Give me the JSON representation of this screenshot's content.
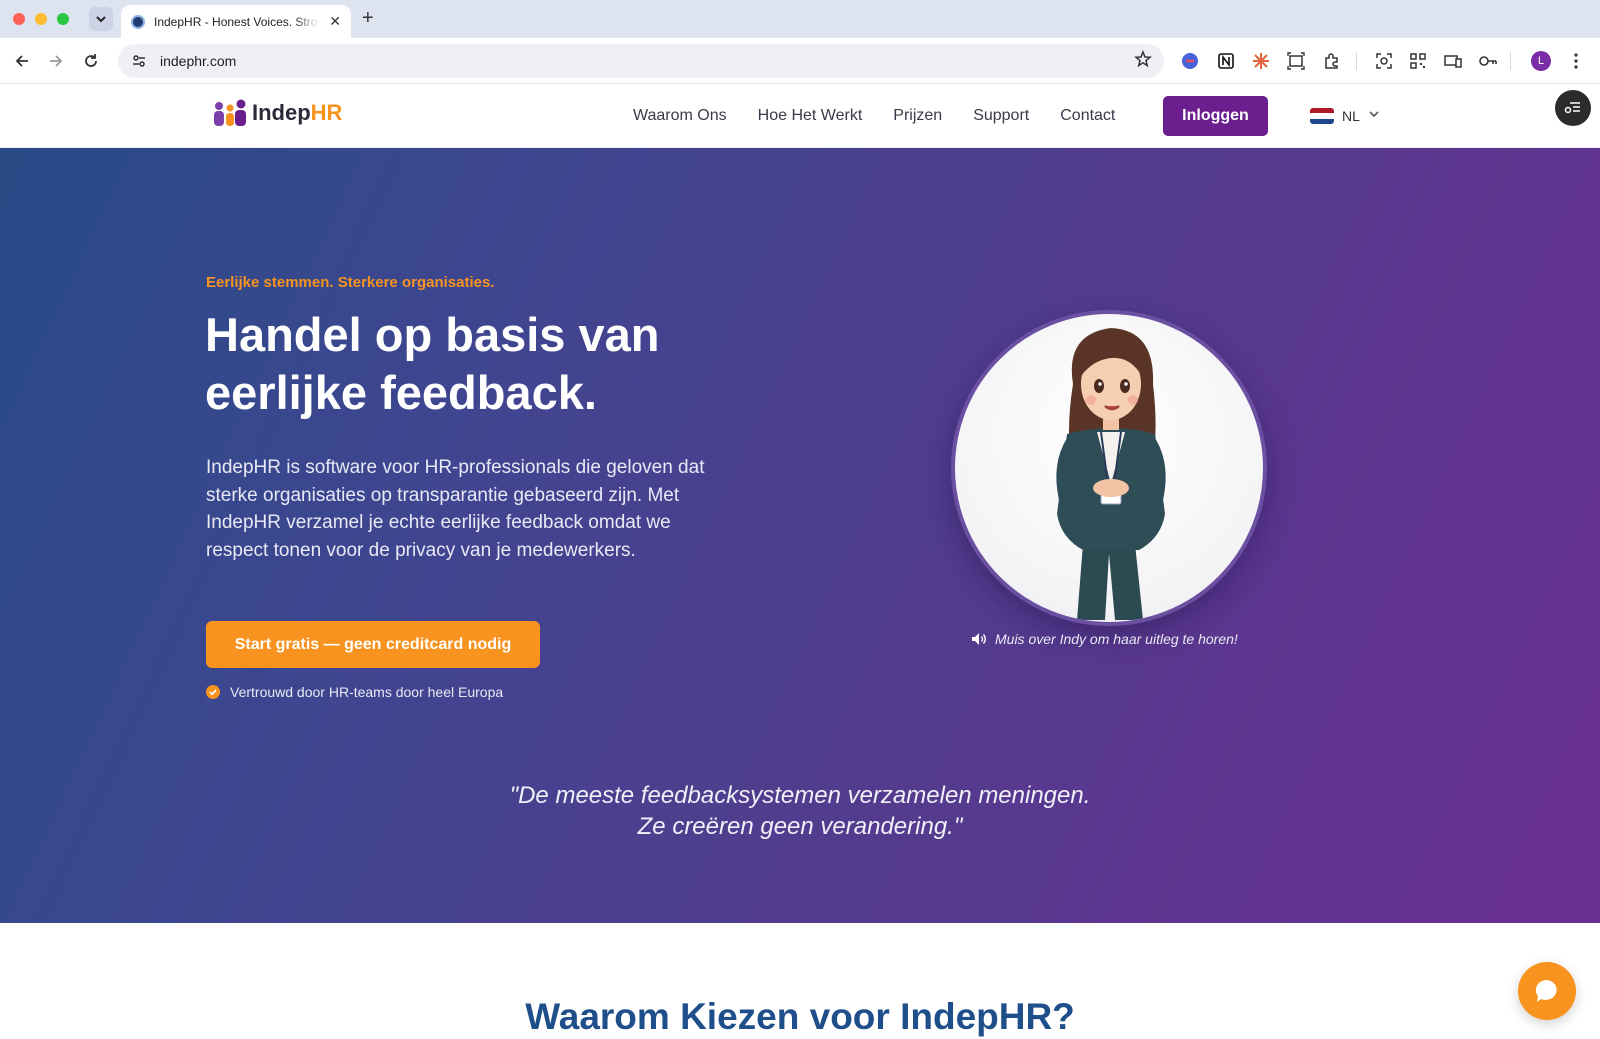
{
  "browser": {
    "tab": {
      "title": "IndepHR - Honest Voices. Stronger Organisations.",
      "close_label": "✕"
    },
    "new_tab_label": "+",
    "url": "indephr.com",
    "profile_initial": "L"
  },
  "header": {
    "logo": {
      "name_main": "Indep",
      "name_accent": "HR"
    },
    "nav": [
      "Waarom Ons",
      "Hoe Het Werkt",
      "Prijzen",
      "Support",
      "Contact"
    ],
    "login_label": "Inloggen",
    "language": {
      "code": "NL",
      "flag_colors": [
        "#ae1c28",
        "#ffffff",
        "#21468b"
      ]
    }
  },
  "hero": {
    "eyebrow": "Eerlijke stemmen. Sterkere organisaties.",
    "title": "Handel op basis van eerlijke feedback.",
    "body": "IndepHR is software voor HR-professionals die geloven dat sterke organisaties op transparantie gebaseerd zijn. Met IndepHR verzamel je echte eerlijke feedback omdat we respect tonen voor de privacy van je medewerkers.",
    "cta_label": "Start gratis — geen creditcard nodig",
    "trust_text": "Vertrouwd door HR-teams door heel Europa",
    "avatar_caption": "Muis over Indy om haar uitleg te horen!",
    "quote_line1": "\"De meeste feedbacksystemen verzamelen meningen.",
    "quote_line2": "Ze creëren geen verandering.\""
  },
  "section": {
    "title": "Waarom Kiezen voor IndepHR?"
  },
  "colors": {
    "accent_orange": "#f7931e",
    "brand_purple": "#6b1f8f",
    "heading_blue": "#1f4f8a"
  }
}
